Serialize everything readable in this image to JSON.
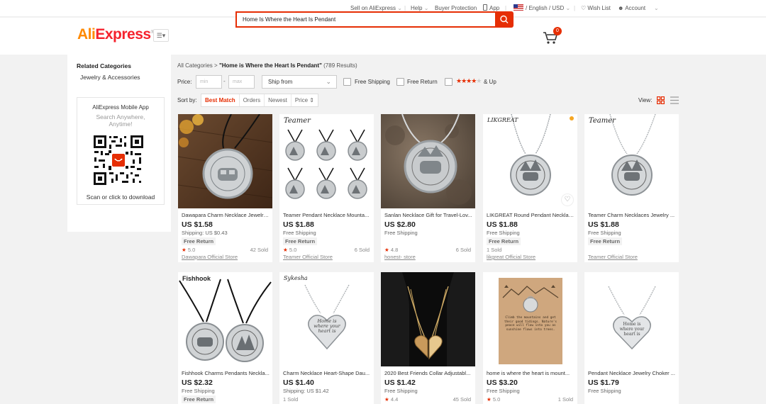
{
  "topbar": {
    "sell": "Sell on AliExpress",
    "help": "Help",
    "buyer_protection": "Buyer Protection",
    "app": "App",
    "locale": "/ English /  USD",
    "wishlist": "Wish List",
    "account": "Account"
  },
  "header": {
    "logo_ali": "Ali",
    "logo_express": "Express",
    "logo_reg": "®",
    "search_value": "Home Is Where the Heart Is Pendant",
    "cart_count": "0"
  },
  "sidebar": {
    "related_title": "Related Categories",
    "category": "Jewelry & Accessories",
    "app_title": "AliExpress Mobile App",
    "app_subtitle": "Search Anywhere, Anytime!",
    "app_scan": "Scan or click to download"
  },
  "breadcrumb": {
    "all": "All Categories",
    "sep": " > ",
    "query": "\"Home is Where the Heart Is Pendant\"",
    "count": "(789 Results)"
  },
  "filters": {
    "price_label": "Price:",
    "min_placeholder": "min",
    "max_placeholder": "max",
    "dash": "-",
    "ship_from": "Ship from",
    "free_shipping": "Free Shipping",
    "free_return": "Free Return",
    "up": "& Up"
  },
  "sort": {
    "label": "Sort by:",
    "options": [
      "Best Match",
      "Orders",
      "Newest",
      "Price ⇕"
    ],
    "view_label": "View:"
  },
  "products": [
    {
      "title": "Dawapara Charm Necklace Jewelry...",
      "price": "US $1.58",
      "shipping": "Shipping: US $0.43",
      "free_return": "Free Return",
      "rating": "5.0",
      "sold": "42 Sold",
      "store": "Dawapara Official Store",
      "brand": ""
    },
    {
      "title": "Teamer Pendant Necklace Mounta...",
      "price": "US $1.88",
      "shipping": "Free Shipping",
      "free_return": "Free Return",
      "rating": "5.0",
      "sold": "6 Sold",
      "store": "Teamer Official Store",
      "brand": "Teamer"
    },
    {
      "title": "Sanlan Necklace Gift for Travel-Lov...",
      "price": "US $2.80",
      "shipping": "Free Shipping",
      "free_return": "",
      "rating": "4.8",
      "sold": "6 Sold",
      "store": "honest- store",
      "brand": ""
    },
    {
      "title": "LIKGREAT Round Pendant Necklac...",
      "price": "US $1.88",
      "shipping": "Free Shipping",
      "free_return": "Free Return",
      "rating": "",
      "sold": "1 Sold",
      "store": "likgreat Official Store",
      "brand": "LIKGREAT"
    },
    {
      "title": "Teamer Charm Necklaces Jewelry ...",
      "price": "US $1.88",
      "shipping": "Free Shipping",
      "free_return": "Free Return",
      "rating": "",
      "sold": "",
      "store": "Teamer Official Store",
      "brand": "Teamer"
    },
    {
      "title": "Fishhook Charms Pendants Neckla...",
      "price": "US $2.32",
      "shipping": "Free Shipping",
      "free_return": "Free Return",
      "rating": "",
      "sold": "",
      "store": "",
      "brand": "Fishhook"
    },
    {
      "title": "Charm Necklace Heart-Shape Dau...",
      "price": "US $1.40",
      "shipping": "Shipping: US $1.42",
      "free_return": "",
      "rating": "",
      "sold": "1 Sold",
      "store": "",
      "brand": "Sykesha"
    },
    {
      "title": "2020 Best Friends Collar Adjustabl...",
      "price": "US $1.42",
      "shipping": "Free Shipping",
      "free_return": "",
      "rating": "4.4",
      "sold": "45 Sold",
      "store": "",
      "brand": ""
    },
    {
      "title": "home is where the heart is mount...",
      "price": "US $3.20",
      "shipping": "Free Shipping",
      "free_return": "",
      "rating": "5.0",
      "sold": "1 Sold",
      "store": "",
      "brand": ""
    },
    {
      "title": "Pendant Necklace Jewelry Choker ...",
      "price": "US $1.79",
      "shipping": "Free Shipping",
      "free_return": "",
      "rating": "",
      "sold": "",
      "store": "",
      "brand": ""
    }
  ],
  "pendant_text": {
    "line1": "Home is",
    "line2": "where your",
    "line3": "heart is"
  },
  "card_text": "Climb the mountains and get their good tidings. Nature's peace will flow into you as sunshine flows into trees.",
  "colors": {
    "accent": "#e62e04",
    "brand_orange": "#ff8a00",
    "brand_red": "#f5222d"
  }
}
